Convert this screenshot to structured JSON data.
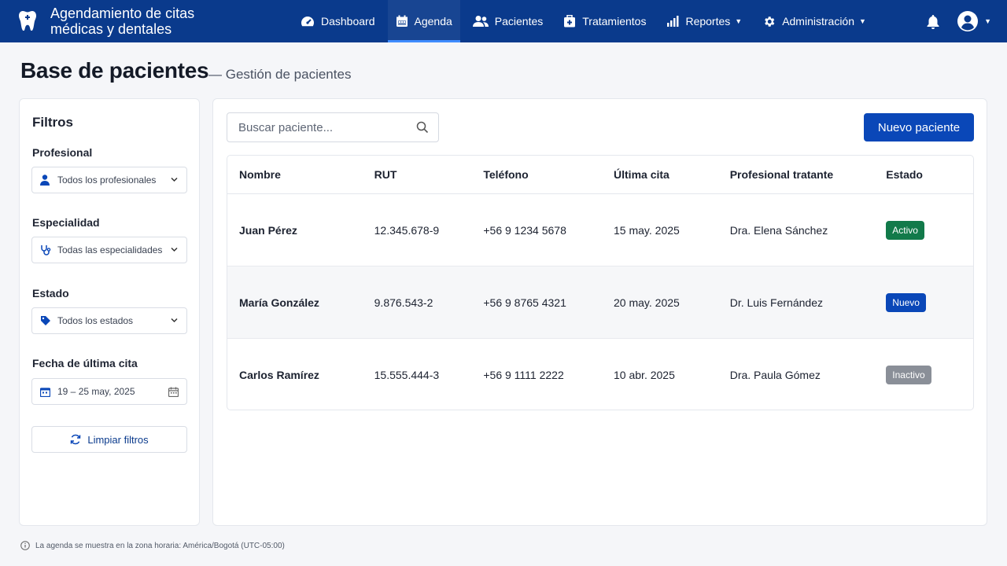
{
  "app": {
    "title": "Agendamiento de citas médicas y dentales"
  },
  "nav": {
    "items": [
      {
        "label": "Dashboard",
        "icon": "gauge-icon"
      },
      {
        "label": "Agenda",
        "icon": "calendar-icon",
        "active": true
      },
      {
        "label": "Pacientes",
        "icon": "users-icon"
      },
      {
        "label": "Tratamientos",
        "icon": "first-aid-icon"
      },
      {
        "label": "Reportes",
        "icon": "bar-chart-icon",
        "dropdown": true
      },
      {
        "label": "Administración",
        "icon": "gear-icon",
        "dropdown": true
      }
    ]
  },
  "page": {
    "title": "Base de pacientes",
    "subtitle": "— Gestión de pacientes"
  },
  "filters": {
    "title": "Filtros",
    "profesional": {
      "label": "Profesional",
      "value": "Todos los profesionales"
    },
    "especialidad": {
      "label": "Especialidad",
      "value": "Todas las especialidades"
    },
    "estado": {
      "label": "Estado",
      "value": "Todos los estados"
    },
    "fecha": {
      "label": "Fecha de última cita",
      "value": "19 – 25 may, 2025"
    },
    "clear_label": "Limpiar filtros"
  },
  "search": {
    "placeholder": "Buscar paciente..."
  },
  "new_patient_label": "Nuevo paciente",
  "table": {
    "headers": [
      "Nombre",
      "RUT",
      "Teléfono",
      "Última cita",
      "Profesional tratante",
      "Estado"
    ],
    "rows": [
      {
        "nombre": "Juan Pérez",
        "rut": "12.345.678-9",
        "telefono": "+56 9 1234 5678",
        "ultima_cita": "15 may. 2025",
        "profesional": "Dra. Elena Sánchez",
        "estado": "Activo"
      },
      {
        "nombre": "María González",
        "rut": "9.876.543-2",
        "telefono": "+56 9 8765 4321",
        "ultima_cita": "20 may. 2025",
        "profesional": "Dr. Luis Fernández",
        "estado": "Nuevo"
      },
      {
        "nombre": "Carlos Ramírez",
        "rut": "15.555.444-3",
        "telefono": "+56 9 1111 2222",
        "ultima_cita": "10 abr. 2025",
        "profesional": "Dra. Paula Gómez",
        "estado": "Inactivo"
      }
    ]
  },
  "footer": {
    "note": "La agenda se muestra en la zona horaria: América/Bogotá (UTC-05:00)"
  },
  "colors": {
    "topbar": "#0a3a8c",
    "primary": "#0a47b8",
    "active": "#127a4a",
    "inactive": "#8a8f98"
  }
}
